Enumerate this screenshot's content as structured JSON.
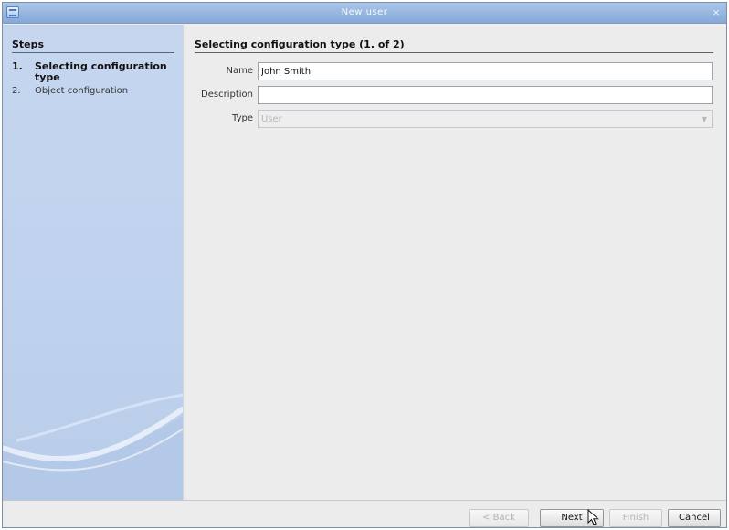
{
  "window": {
    "title": "New user",
    "close_label": "×"
  },
  "sidebar": {
    "heading": "Steps",
    "steps": [
      {
        "number": "1.",
        "label": "Selecting configuration type",
        "active": true
      },
      {
        "number": "2.",
        "label": "Object configuration",
        "active": false
      }
    ]
  },
  "main": {
    "heading": "Selecting configuration type (1. of 2)",
    "fields": {
      "name": {
        "label": "Name",
        "value": "John Smith"
      },
      "description": {
        "label": "Description",
        "value": ""
      },
      "type": {
        "label": "Type",
        "value": "User",
        "disabled": true
      }
    }
  },
  "buttons": {
    "back": "< Back",
    "next": "Next",
    "finish": "Finish",
    "cancel": "Cancel"
  }
}
